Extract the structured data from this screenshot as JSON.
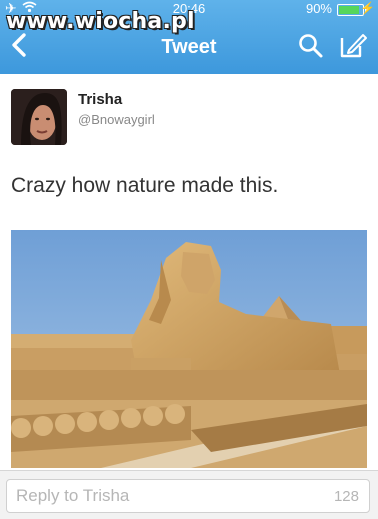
{
  "watermark": "www.wiocha.pl",
  "status_bar": {
    "time": "20:46",
    "battery_percent": "90%",
    "battery_level": 0.9,
    "airplane_icon": "airplane-icon",
    "wifi_icon": "wifi-icon"
  },
  "nav": {
    "title": "Tweet",
    "back_icon": "chevron-left-icon",
    "search_icon": "search-icon",
    "compose_icon": "compose-icon"
  },
  "tweet": {
    "author_name": "Trisha",
    "author_handle": "@Bnowaygirl",
    "text": "Crazy how nature made this."
  },
  "reply": {
    "placeholder": "Reply to Trisha",
    "char_count": "128"
  },
  "colors": {
    "nav_bar": "#3d98dc",
    "reply_bar": "#f2f2f2"
  }
}
